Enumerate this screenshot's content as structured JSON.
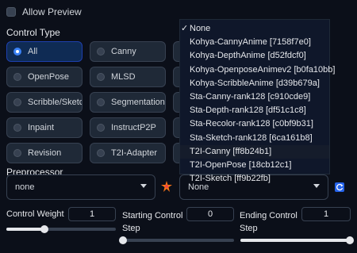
{
  "allow_preview": {
    "label": "Allow Preview",
    "checked": false
  },
  "control_type": {
    "label": "Control Type",
    "selected": "All",
    "options": [
      "All",
      "Canny",
      "",
      "OpenPose",
      "MLSD",
      "",
      "Scribble/Sketch",
      "Segmentation",
      "",
      "Inpaint",
      "InstructP2P",
      "",
      "Revision",
      "T2I-Adapter",
      ""
    ]
  },
  "preprocessor": {
    "label": "Preprocessor",
    "value": "none"
  },
  "model": {
    "value": "None",
    "options": [
      "None",
      "Kohya-CannyAnime [7158f7e0]",
      "Kohya-DepthAnime [d52fdcf0]",
      "Kohya-OpenposeAnimev2 [b0fa10bb]",
      "Kohya-ScribbleAnime [d39b679a]",
      "Sta-Canny-rank128 [c910cde9]",
      "Sta-Depth-rank128 [df51c1c8]",
      "Sta-Recolor-rank128 [c0bf9b31]",
      "Sta-Sketch-rank128 [6ca161b8]",
      "T2I-Canny [ff8b24b1]",
      "T2I-OpenPose [18cb12c1]",
      "T2I-Sketch [ff9b22fb]"
    ],
    "checked_mark": "✓"
  },
  "control_weight": {
    "label": "Control Weight",
    "value": "1",
    "fraction": 0.35
  },
  "starting_step": {
    "label1": "Starting Control",
    "label2": "Step",
    "value": "0",
    "fraction": 0.0
  },
  "ending_step": {
    "label1": "Ending Control",
    "label2": "Step",
    "value": "1",
    "fraction": 1.0
  },
  "colors": {
    "accent": "#3b82f6",
    "bg": "#0b0f19",
    "warn": "#f97316",
    "refresh": "#60a5fa"
  }
}
